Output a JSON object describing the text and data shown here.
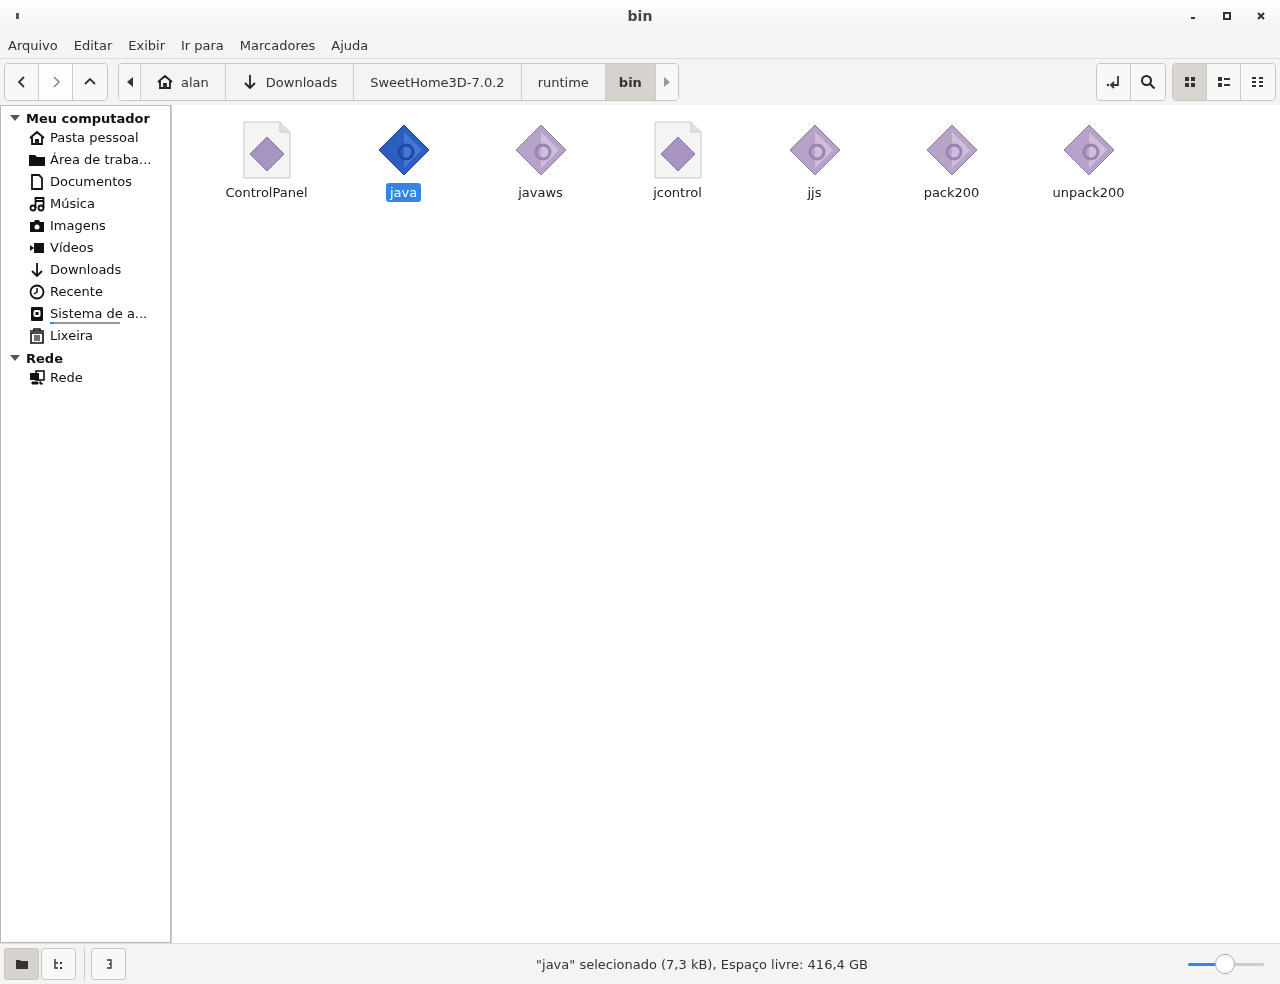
{
  "window": {
    "title": "bin"
  },
  "menu": [
    "Arquivo",
    "Editar",
    "Exibir",
    "Ir para",
    "Marcadores",
    "Ajuda"
  ],
  "breadcrumbs": [
    {
      "label": "alan",
      "kind": "home",
      "selected": false
    },
    {
      "label": "Downloads",
      "kind": "download",
      "selected": false
    },
    {
      "label": "SweetHome3D-7.0.2",
      "kind": "plain",
      "selected": false
    },
    {
      "label": "runtime",
      "kind": "plain",
      "selected": false
    },
    {
      "label": "bin",
      "kind": "plain",
      "selected": true
    }
  ],
  "view_modes": [
    {
      "kind": "icons",
      "selected": true
    },
    {
      "kind": "list",
      "selected": false
    },
    {
      "kind": "compact",
      "selected": false
    }
  ],
  "sidebar": [
    {
      "label": "Meu computador",
      "expanded": true,
      "items": [
        {
          "label": "Pasta pessoal",
          "kind": "home"
        },
        {
          "label": "Área de traba...",
          "kind": "folder"
        },
        {
          "label": "Documentos",
          "kind": "document"
        },
        {
          "label": "Música",
          "kind": "music"
        },
        {
          "label": "Imagens",
          "kind": "camera"
        },
        {
          "label": "Vídeos",
          "kind": "video"
        },
        {
          "label": "Downloads",
          "kind": "download"
        },
        {
          "label": "Recente",
          "kind": "clock"
        },
        {
          "label": "Sistema de a...",
          "kind": "drive",
          "level": 0.06
        },
        {
          "label": "Lixeira",
          "kind": "trash"
        }
      ]
    },
    {
      "label": "Rede",
      "expanded": true,
      "items": [
        {
          "label": "Rede",
          "kind": "network"
        }
      ]
    }
  ],
  "files": [
    {
      "name": "ControlPanel",
      "kind": "document",
      "selected": false
    },
    {
      "name": "java",
      "kind": "executable",
      "selected": true
    },
    {
      "name": "javaws",
      "kind": "executable",
      "selected": false
    },
    {
      "name": "jcontrol",
      "kind": "document",
      "selected": false
    },
    {
      "name": "jjs",
      "kind": "executable",
      "selected": false
    },
    {
      "name": "pack200",
      "kind": "executable",
      "selected": false
    },
    {
      "name": "unpack200",
      "kind": "executable",
      "selected": false
    }
  ],
  "status_bar": {
    "pane_modes": [
      {
        "kind": "places",
        "selected": true
      },
      {
        "kind": "tree",
        "selected": false
      }
    ],
    "text": "\"java\" selecionado (7,3 kB), Espaço livre: 416,4 GB",
    "zoom": {
      "level": 0.49
    }
  }
}
